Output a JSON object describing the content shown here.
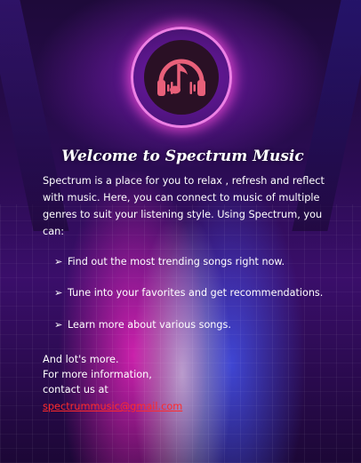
{
  "header": {
    "title": "Welcome to Spectrum Music",
    "logo_icon": "headphones-music-note-icon"
  },
  "intro": {
    "text": "Spectrum is a place for you to relax , refresh and reflect with music. Here, you can connect to music of multiple genres to suit your listening style. Using Spectrum, you can:"
  },
  "features": [
    {
      "arrow": "➢",
      "text": "Find out the most trending songs right now."
    },
    {
      "arrow": "➢",
      "text": "Tune into your favorites and get recommendations."
    },
    {
      "arrow": "➢",
      "text": "Learn more about various songs."
    }
  ],
  "outro": {
    "line1": "And lot's more.",
    "line2": "For more information,",
    "line3": "contact us at"
  },
  "contact": {
    "email": "spectrummusic@gmail.com"
  },
  "colors": {
    "accent_pink": "#ff50dc",
    "link_red": "#ff2a2a",
    "logo_fill": "#e8607a"
  }
}
